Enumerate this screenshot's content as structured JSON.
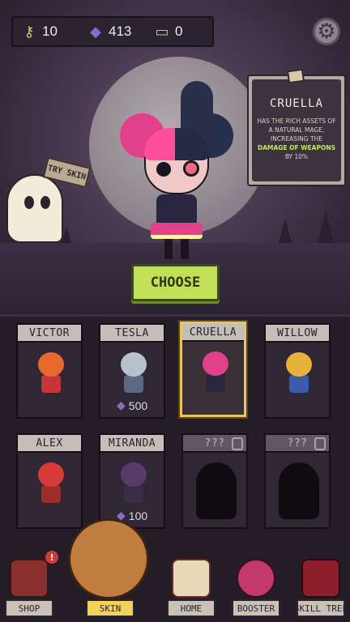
{
  "topbar": {
    "keys": {
      "icon": "key-plus-icon",
      "value": "10"
    },
    "gems": {
      "icon": "gem-plus-icon",
      "value": "413"
    },
    "tickets": {
      "icon": "ticket-plus-icon",
      "value": "0"
    },
    "settings_icon": "gear-icon"
  },
  "try_sign": "TRY SKIN",
  "info": {
    "name": "CRUELLA",
    "desc_pre": "HAS THE RICH ASSETS OF A NATURAL MAGE, INCREASING THE",
    "desc_hl": "DAMAGE OF WEAPONS",
    "desc_post": "BY 10%"
  },
  "choose_label": "CHOOSE",
  "skins": [
    {
      "name": "VICTOR",
      "price": "",
      "locked": false,
      "selected": false,
      "hair": "#e8692b",
      "body": "#c5353b"
    },
    {
      "name": "TESLA",
      "price": "500",
      "locked": false,
      "selected": false,
      "hair": "#b7c2cf",
      "body": "#5b6a80"
    },
    {
      "name": "CRUELLA",
      "price": "",
      "locked": false,
      "selected": true,
      "hair": "#e0418a",
      "body": "#2a2540"
    },
    {
      "name": "WILLOW",
      "price": "",
      "locked": false,
      "selected": false,
      "hair": "#e5b23a",
      "body": "#3b5aa8"
    },
    {
      "name": "ALEX",
      "price": "",
      "locked": false,
      "selected": false,
      "hair": "#d83a3a",
      "body": "#9b2d2d"
    },
    {
      "name": "MIRANDA",
      "price": "100",
      "locked": false,
      "selected": false,
      "hair": "#5a3a6b",
      "body": "#3b2c4a"
    },
    {
      "name": "???",
      "price": "",
      "locked": true,
      "selected": false
    },
    {
      "name": "???",
      "price": "",
      "locked": true,
      "selected": false
    }
  ],
  "nav": {
    "shop": "SHOP",
    "skin": "SKIN",
    "home": "HOME",
    "booster": "BOOSTER",
    "skill_tree": "SKILL TREE",
    "shop_alert": "!"
  }
}
